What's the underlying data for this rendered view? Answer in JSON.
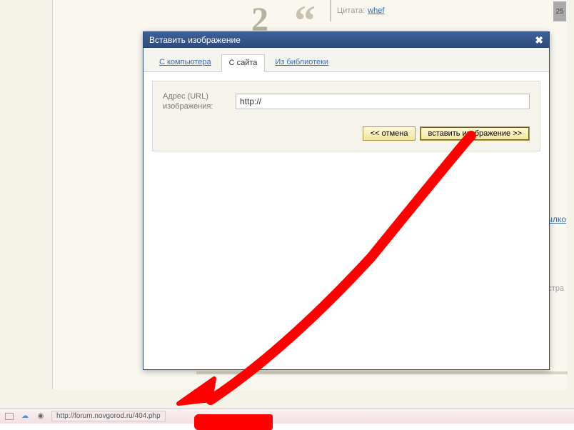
{
  "background": {
    "day_number": "2",
    "quote_prefix": "Цитата:",
    "quote_user": "whef",
    "right_badge": "25",
    "right_link": "ылко",
    "right_text": "стра"
  },
  "dialog": {
    "title": "Вставить изображение",
    "tabs": {
      "from_computer": "С компьютера",
      "from_site": "С сайта",
      "from_library": "Из библиотеки"
    },
    "url_label": "Адрес (URL) изображения:",
    "url_value": "http://",
    "cancel_label": "<< отмена",
    "insert_label": "вставить изображение >>"
  },
  "taskbar": {
    "url": "http://forum.novgorod.ru/404.php"
  }
}
